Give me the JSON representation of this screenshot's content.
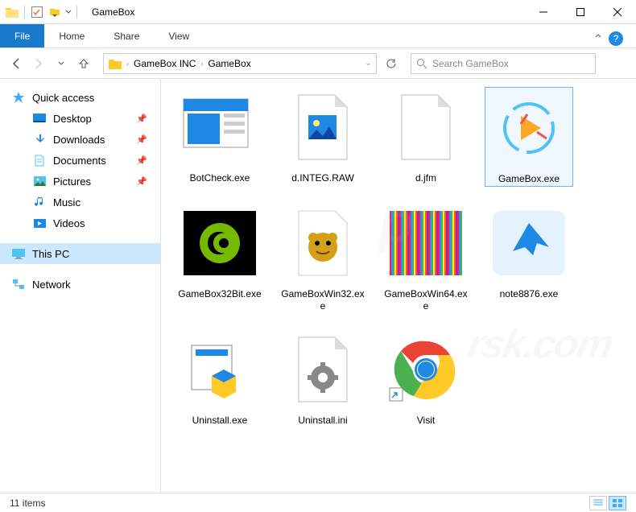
{
  "window": {
    "title": "GameBox"
  },
  "ribbon": {
    "file": "File",
    "tabs": [
      "Home",
      "Share",
      "View"
    ]
  },
  "breadcrumb": {
    "items": [
      "GameBox INC",
      "GameBox"
    ]
  },
  "search": {
    "placeholder": "Search GameBox"
  },
  "sidebar": {
    "quick_access": "Quick access",
    "items": [
      {
        "label": "Desktop",
        "pinned": true
      },
      {
        "label": "Downloads",
        "pinned": true
      },
      {
        "label": "Documents",
        "pinned": true
      },
      {
        "label": "Pictures",
        "pinned": true
      },
      {
        "label": "Music",
        "pinned": false
      },
      {
        "label": "Videos",
        "pinned": false
      }
    ],
    "this_pc": "This PC",
    "network": "Network"
  },
  "files": [
    {
      "name": "BotCheck.exe",
      "type": "app-window"
    },
    {
      "name": "d.INTEG.RAW",
      "type": "image-file"
    },
    {
      "name": "d.jfm",
      "type": "blank-file"
    },
    {
      "name": "GameBox.exe",
      "type": "gamebox",
      "selected": true
    },
    {
      "name": "GameBox32Bit.exe",
      "type": "nvidia"
    },
    {
      "name": "GameBoxWin32.exe",
      "type": "hamster"
    },
    {
      "name": "GameBoxWin64.exe",
      "type": "rainbow"
    },
    {
      "name": "note8876.exe",
      "type": "bluebird"
    },
    {
      "name": "Uninstall.exe",
      "type": "uninstall"
    },
    {
      "name": "Uninstall.ini",
      "type": "ini-file"
    },
    {
      "name": "Visit",
      "type": "chrome",
      "shortcut": true
    }
  ],
  "status": {
    "text": "11 items"
  }
}
